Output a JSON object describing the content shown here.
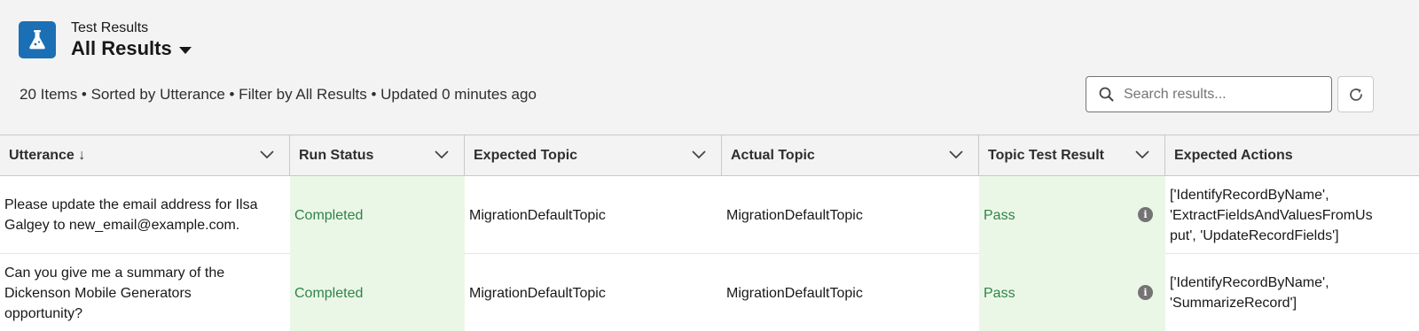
{
  "header": {
    "subtitle": "Test Results",
    "title": "All Results",
    "meta": "20 Items • Sorted by Utterance • Filter by All Results • Updated 0 minutes ago",
    "icon": "flask-icon",
    "accent": "#1b6fb4"
  },
  "search": {
    "placeholder": "Search results...",
    "value": ""
  },
  "table": {
    "columns": [
      {
        "label": "Utterance ↓"
      },
      {
        "label": "Run Status"
      },
      {
        "label": "Expected Topic"
      },
      {
        "label": "Actual Topic"
      },
      {
        "label": "Topic Test Result"
      },
      {
        "label": "Expected Actions"
      }
    ],
    "rows": [
      {
        "utterance_line1": "Please update the email address for Ilsa",
        "utterance_line2": "Galgey to new_email@example.com.",
        "utterance_line3": "",
        "run_status": "Completed",
        "expected_topic": "MigrationDefaultTopic",
        "actual_topic": "MigrationDefaultTopic",
        "topic_result": "Pass",
        "actions_line1": "['IdentifyRecordByName',",
        "actions_line2": "'ExtractFieldsAndValuesFromUs",
        "actions_line3": "put', 'UpdateRecordFields']"
      },
      {
        "utterance_line1": "Can you give me a summary of the",
        "utterance_line2": "Dickenson Mobile Generators",
        "utterance_line3": "opportunity?",
        "run_status": "Completed",
        "expected_topic": "MigrationDefaultTopic",
        "actual_topic": "MigrationDefaultTopic",
        "topic_result": "Pass",
        "actions_line1": "['IdentifyRecordByName',",
        "actions_line2": "'SummarizeRecord']",
        "actions_line3": ""
      }
    ]
  },
  "colors": {
    "pass_bg": "#ebf7e6",
    "pass_text": "#2e844a"
  }
}
